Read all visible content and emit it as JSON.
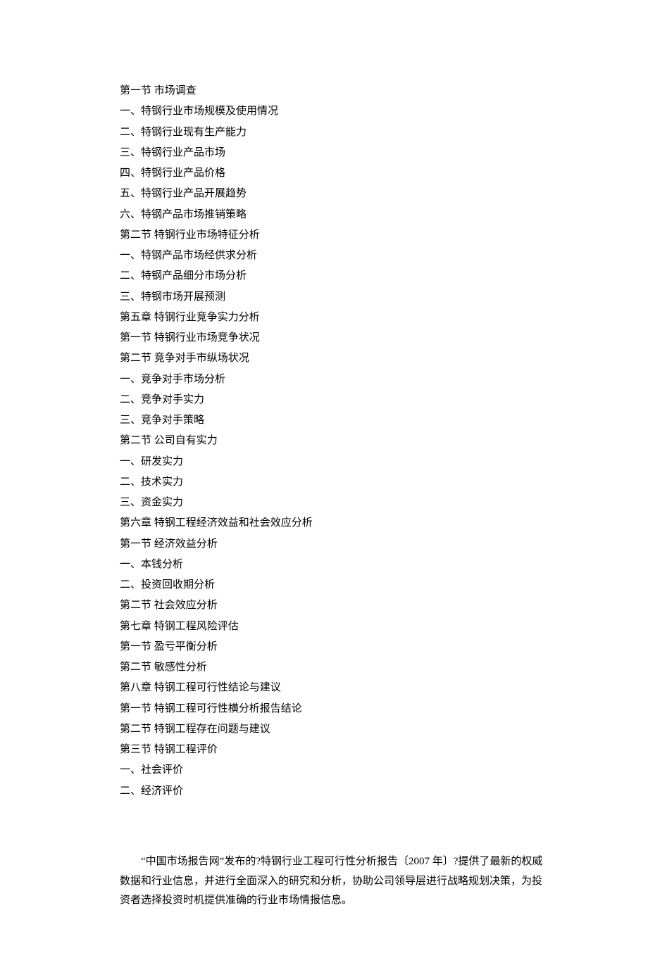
{
  "toc": [
    "第一节  市场调查",
    "一、特钢行业市场规模及使用情况",
    "二、特钢行业现有生产能力",
    "三、特钢行业产品市场",
    "四、特钢行业产品价格",
    "五、特钢行业产品开展趋势",
    "六、特钢产品市场推销策略",
    "第二节  特钢行业市场特征分析",
    "一、特钢产品市场经供求分析",
    "二、特钢产品细分市场分析",
    "三、特钢市场开展预测",
    "第五章  特钢行业竞争实力分析",
    "第一节  特钢行业市场竞争状况",
    "第二节  竞争对手市纵场状况",
    "一、竞争对手市场分析",
    "二、竞争对手实力",
    "三、竞争对手策略",
    "第二节  公司自有实力",
    "一、研发实力",
    "二、技术实力",
    "三、资金实力",
    "第六章  特钢工程经济效益和社会效应分析",
    "第一节  经济效益分析",
    "一、本钱分析",
    "二、投资回收期分析",
    "第二节  社会效应分析",
    "第七章  特钢工程风险评估",
    "第一节  盈亏平衡分析",
    "第二节  敏感性分析",
    "第八章  特钢工程可行性结论与建议",
    "第一节  特钢工程可行性横分析报告结论",
    "第二节  特钢工程存在问题与建议",
    "第三节  特钢工程评价",
    "一、社会评价",
    "二、经济评价"
  ],
  "summary": "“中国市场报告网”发布的?特钢行业工程可行性分析报告〔2007 年〕?提供了最新的权威数据和行业信息，并进行全面深入的研究和分析，协助公司领导层进行战略规划决策，为投资者选择投资时机提供准确的行业市场情报信息。"
}
